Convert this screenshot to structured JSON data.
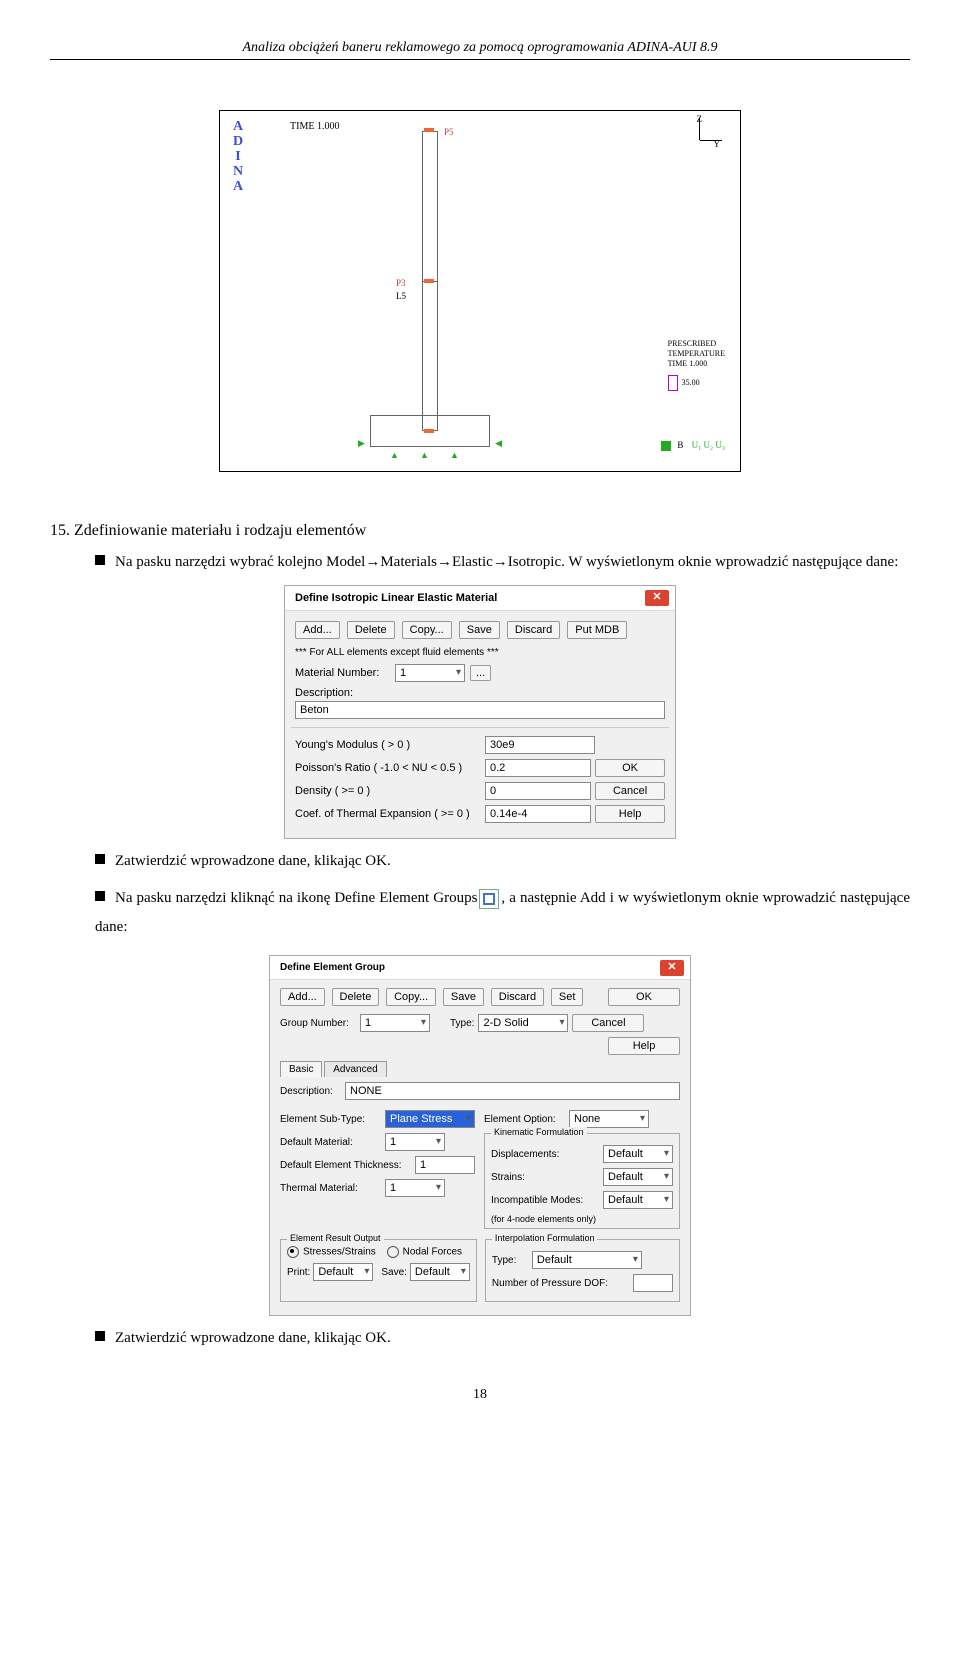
{
  "header": "Analiza obciążeń baneru reklamowego za pomocą oprogramowania ADINA-AUI 8.9",
  "pagenum": "18",
  "figure": {
    "adina": [
      "A",
      "D",
      "I",
      "N",
      "A"
    ],
    "time": "TIME 1.000",
    "axis_z": "Z",
    "axis_y": "Y",
    "p5": "P5",
    "p3": "P3",
    "l5": "L5",
    "legend_title": "PRESCRIBED\nTEMPERATURE",
    "legend_time": "TIME 1.000",
    "legend_val": "35.00",
    "bc": "B",
    "bc_u": "U₁ U₂ U₃"
  },
  "section15_title": "15. Zdefiniowanie materiału i rodzaju elementów",
  "bullet1": "Na pasku narzędzi wybrać kolejno Model→Materials→Elastic→Isotropic. W wyświetlonym oknie wprowadzić następujące dane:",
  "bullet2": "Zatwierdzić wprowadzone dane, klikając OK.",
  "bullet3a": "Na pasku narzędzi kliknąć na ikonę Define Element Groups",
  "bullet3b": ", a następnie Add i w wyświetlonym oknie wprowadzić następujące dane:",
  "bullet4": "Zatwierdzić wprowadzone dane, klikając OK.",
  "dlg1": {
    "title": "Define Isotropic Linear Elastic Material",
    "btns": {
      "add": "Add...",
      "delete": "Delete",
      "copy": "Copy...",
      "save": "Save",
      "discard": "Discard",
      "putmdb": "Put MDB"
    },
    "hint": "*** For ALL elements except fluid elements ***",
    "matnum_label": "Material Number:",
    "matnum_val": "1",
    "dots": "...",
    "desc_label": "Description:",
    "desc_val": "Beton",
    "youngs_label": "Young's Modulus ( > 0 )",
    "youngs_val": "30e9",
    "pois_label": "Poisson's Ratio ( -1.0 < NU < 0.5 )",
    "pois_val": "0.2",
    "dens_label": "Density ( >= 0 )",
    "dens_val": "0",
    "cte_label": "Coef. of Thermal Expansion ( >= 0 )",
    "cte_val": "0.14e-4",
    "ok": "OK",
    "cancel": "Cancel",
    "help": "Help"
  },
  "dlg2": {
    "title": "Define Element Group",
    "btns": {
      "add": "Add...",
      "delete": "Delete",
      "copy": "Copy...",
      "save": "Save",
      "discard": "Discard",
      "set": "Set"
    },
    "ok": "OK",
    "cancel": "Cancel",
    "help": "Help",
    "gn_label": "Group Number:",
    "gn_val": "1",
    "type_label": "Type:",
    "type_val": "2-D Solid",
    "tab_basic": "Basic",
    "tab_adv": "Advanced",
    "desc_label": "Description:",
    "desc_val": "NONE",
    "subtype_label": "Element Sub-Type:",
    "subtype_val": "Plane Stress",
    "eopt_label": "Element Option:",
    "eopt_val": "None",
    "defmat_label": "Default Material:",
    "defmat_val": "1",
    "thick_label": "Default Element Thickness:",
    "thick_val": "1",
    "thermal_label": "Thermal Material:",
    "thermal_val": "1",
    "kin_title": "Kinematic Formulation",
    "disp_label": "Displacements:",
    "disp_val": "Default",
    "strain_label": "Strains:",
    "strain_val": "Default",
    "incomp_label": "Incompatible Modes:",
    "incomp_val": "Default",
    "incomp_note": "(for 4-node elements only)",
    "ero_title": "Element Result Output",
    "ero_opt1": "Stresses/Strains",
    "ero_opt2": "Nodal Forces",
    "print_label": "Print:",
    "print_val": "Default",
    "save_label": "Save:",
    "save_val": "Default",
    "interp_title": "Interpolation Formulation",
    "itype_label": "Type:",
    "itype_val": "Default",
    "npd_label": "Number of Pressure DOF:",
    "npd_val": ""
  }
}
